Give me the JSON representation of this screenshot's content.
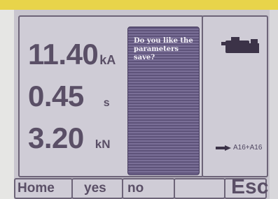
{
  "readings": {
    "current": {
      "value": "11.40",
      "unit": "kA"
    },
    "time": {
      "value": "0.45",
      "unit": "s"
    },
    "force": {
      "value": "3.20",
      "unit": "kN"
    }
  },
  "dialog": {
    "message": "Do you like the parameters save?"
  },
  "status": {
    "mode_icon": "welding-gun-icon",
    "station_icon": "arrow-right-icon",
    "station_label": "A16+A16"
  },
  "softkeys": {
    "home": "Home",
    "yes": "yes",
    "no": "no",
    "blank": "",
    "esc": "Esc"
  },
  "colors": {
    "frame_accent": "#e8d44a",
    "screen_bg": "#c9c6cf",
    "text": "#5a4f66",
    "dialog_bg": "#5e537a"
  }
}
